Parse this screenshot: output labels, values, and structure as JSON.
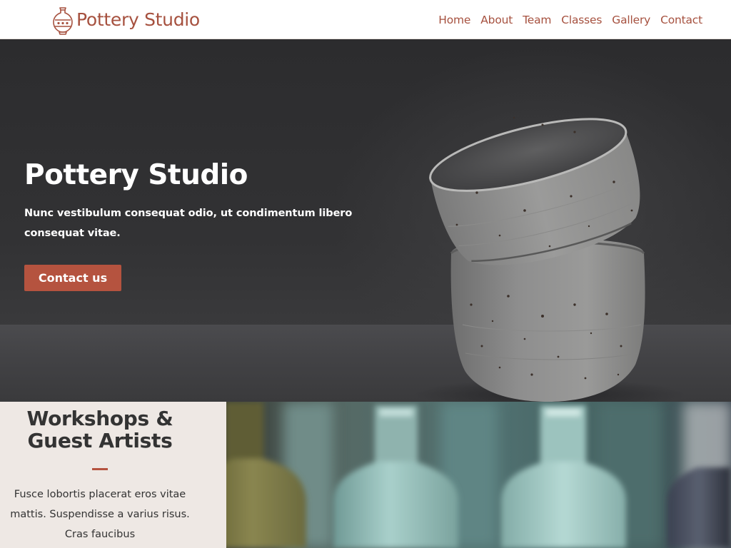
{
  "header": {
    "brand": "Pottery Studio",
    "logo_icon": "vase-icon",
    "nav": [
      {
        "label": "Home"
      },
      {
        "label": "About"
      },
      {
        "label": "Team"
      },
      {
        "label": "Classes"
      },
      {
        "label": "Gallery"
      },
      {
        "label": "Contact"
      }
    ]
  },
  "hero": {
    "title": "Pottery Studio",
    "text": "Nunc vestibulum consequat odio, ut condimentum libero consequat vitae.",
    "button": "Contact us",
    "image": "stacked-ceramic-cups-photo"
  },
  "workshops": {
    "title": "Workshops & Guest Artists",
    "text": "Fusce lobortis placerat eros vitae mattis. Suspendisse a varius risus. Cras faucibus",
    "image": "ceramic-bottles-photo"
  },
  "colors": {
    "accent": "#b5533f",
    "brand_text": "#a6513f",
    "section_bg": "#eee8e4",
    "heading": "#333333"
  }
}
